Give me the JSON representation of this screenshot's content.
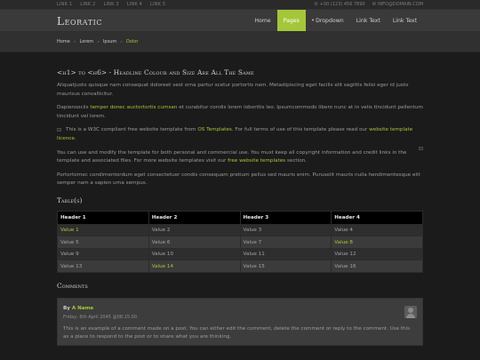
{
  "topbar": {
    "links": [
      "LINK 1",
      "LINK 2",
      "LINK 3",
      "LINK 4",
      "LINK 5"
    ],
    "phone": "+00 (123) 456 7890",
    "email": "INFO@DOMAIN.COM"
  },
  "header": {
    "logo": "Leoratic",
    "nav": [
      "Home",
      "Pages",
      "Dropdown",
      "Link Text",
      "Link Text"
    ]
  },
  "breadcrumbs": [
    "Home",
    "Lorem",
    "Ipsum",
    "Dolor"
  ],
  "content": {
    "title": "<h1> to <h6> - Headline Colour and Size Are All The Same",
    "p1": "Aliquatjusto quisque nam consequat doloreet vest orna partur scetur portortis nam. Metadipiscing eget facilis elit sagittis felisi eger id justo maurisus convallicitur.",
    "p2": {
      "before": "Dapiensociis ",
      "link": "temper donec auctortortis cumsan",
      "after": " et curabitur condis lorem loborttis leo. Ipsumcommodo libero nunc at in velis tincidunt pellentum tincidunt vel lorem."
    },
    "p3": {
      "before": "This is a W3C compliant free website template from ",
      "link1": "OS Templates",
      "middle": ". For full terms of use of this template please read our ",
      "link2": "website template licence",
      "after": "."
    },
    "p4": {
      "before": "You can use and modify the template for both personal and commercial use. You must keep all copyright information and credit links in the template and associated files. For more website templates visit our ",
      "link": "free website templates",
      "after": " section."
    },
    "p5": "Portortornec condimentordum eget consectetuer condis consequam pretium pellus sed mauris enim. Puruselit mauris nulla hendimentesque elit semper nam a sapien urna sempus."
  },
  "table": {
    "title": "Table(s)",
    "headers": [
      "Header 1",
      "Header 2",
      "Header 3",
      "Header 4"
    ],
    "rows": [
      [
        "Value 1",
        "Value 2",
        "Value 3",
        "Value 4"
      ],
      [
        "Value 5",
        "Value 6",
        "Value 7",
        "Value 8"
      ],
      [
        "Value 9",
        "Value 10",
        "Value 11",
        "Value 12"
      ],
      [
        "Value 13",
        "Value 14",
        "Value 15",
        "Value 16"
      ]
    ],
    "highlighted": [
      "Value 1",
      "Value 8",
      "Value 14"
    ]
  },
  "comments": {
    "title": "Comments",
    "item": {
      "by": "By",
      "author": "A Name",
      "date": "Friday, 6th April 2045 @08:15:00",
      "text": "This is an example of a comment made on a post. You can either edit the comment, delete the comment or reply to the comment. Use this as a place to respond to the post or to share what you are thinking."
    }
  },
  "colors": {
    "accent": "#a4c639",
    "background": "#1b1b1b",
    "header": "#3a3a3a",
    "topbar": "#2a2a2a"
  },
  "icons": [
    "phone-icon",
    "email-icon",
    "caret-down-icon",
    "image-placeholder-icon",
    "avatar-icon"
  ]
}
